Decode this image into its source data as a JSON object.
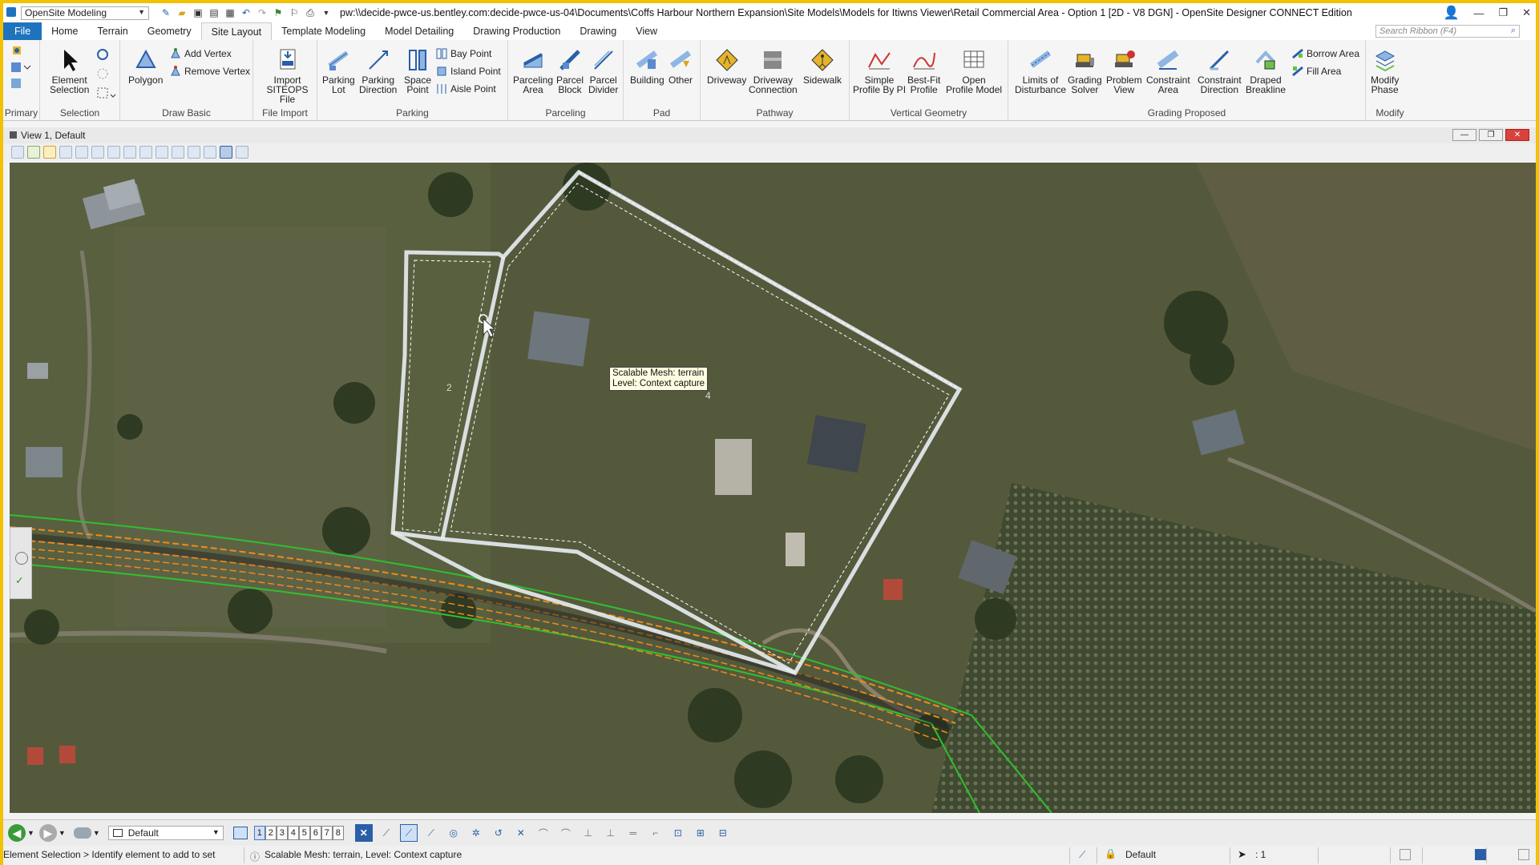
{
  "titlebar": {
    "workspace": "OpenSite Modeling",
    "title": "pw:\\\\decide-pwce-us.bentley.com:decide-pwce-us-04\\Documents\\Coffs Harbour Northern Expansion\\Site Models\\Models for Itiwns Viewer\\Retail Commercial Area - Option 1 [2D - V8 DGN] - OpenSite Designer CONNECT Edition"
  },
  "tabs": [
    "File",
    "Home",
    "Terrain",
    "Geometry",
    "Site Layout",
    "Template Modeling",
    "Model Detailing",
    "Drawing Production",
    "Drawing",
    "View"
  ],
  "active_tab": "Site Layout",
  "search_placeholder": "Search Ribbon (F4)",
  "ribbon": {
    "groups": {
      "primary": "Primary",
      "selection": "Selection",
      "draw_basic": "Draw Basic",
      "file_import": "File Import",
      "parking": "Parking",
      "parceling": "Parceling",
      "pad": "Pad",
      "pathway": "Pathway",
      "vertical_geometry": "Vertical Geometry",
      "grading_proposed": "Grading Proposed",
      "modify": "Modify"
    },
    "buttons": {
      "element_selection": [
        "Element",
        "Selection"
      ],
      "polygon": [
        "Polygon"
      ],
      "add_vertex": "Add Vertex",
      "remove_vertex": "Remove Vertex",
      "import_siteops": [
        "Import",
        "SITEOPS File"
      ],
      "parking_lot": [
        "Parking",
        "Lot"
      ],
      "parking_direction": [
        "Parking",
        "Direction"
      ],
      "space_point": [
        "Space",
        "Point"
      ],
      "bay_point": "Bay Point",
      "island_point": "Island Point",
      "aisle_point": "Aisle Point",
      "parceling_area": [
        "Parceling",
        "Area"
      ],
      "parcel_block": [
        "Parcel",
        "Block"
      ],
      "parcel_divider": [
        "Parcel",
        "Divider"
      ],
      "building": [
        "Building"
      ],
      "other": [
        "Other"
      ],
      "driveway": [
        "Driveway"
      ],
      "driveway_connection": [
        "Driveway",
        "Connection"
      ],
      "sidewalk": [
        "Sidewalk"
      ],
      "simple_profile": [
        "Simple",
        "Profile By PI"
      ],
      "bestfit_profile": [
        "Best-Fit",
        "Profile"
      ],
      "open_profile_model": [
        "Open",
        "Profile Model"
      ],
      "limits_disturbance": [
        "Limits of",
        "Disturbance"
      ],
      "grading_solver": [
        "Grading",
        "Solver"
      ],
      "problem_view": [
        "Problem",
        "View"
      ],
      "constraint_area": [
        "Constraint",
        "Area"
      ],
      "constraint_direction": [
        "Constraint",
        "Direction"
      ],
      "draped_breakline": [
        "Draped",
        "Breakline"
      ],
      "borrow_area": "Borrow Area",
      "fill_area": "Fill Area",
      "modify_phase": [
        "Modify",
        "Phase"
      ]
    }
  },
  "view": {
    "title": "View 1, Default",
    "tooltip_line1": "Scalable Mesh: terrain",
    "tooltip_line2": "Level: Context capture",
    "parcel_labels": {
      "p2": "2",
      "p4": "4"
    }
  },
  "bottombar": {
    "level": "Default",
    "view_numbers": [
      "1",
      "2",
      "3",
      "4",
      "5",
      "6",
      "7",
      "8"
    ]
  },
  "status": {
    "prompt": "Element Selection > Identify element to add to set",
    "message": "Scalable Mesh: terrain, Level: Context capture",
    "active_level": "Default",
    "count": ": 1"
  },
  "colors": {
    "accent": "#1e73be",
    "border": "#f2c100",
    "parcel_outline": "#e8edf2",
    "rail_green": "#2fbf2f",
    "rail_orange": "#f08a1c"
  }
}
